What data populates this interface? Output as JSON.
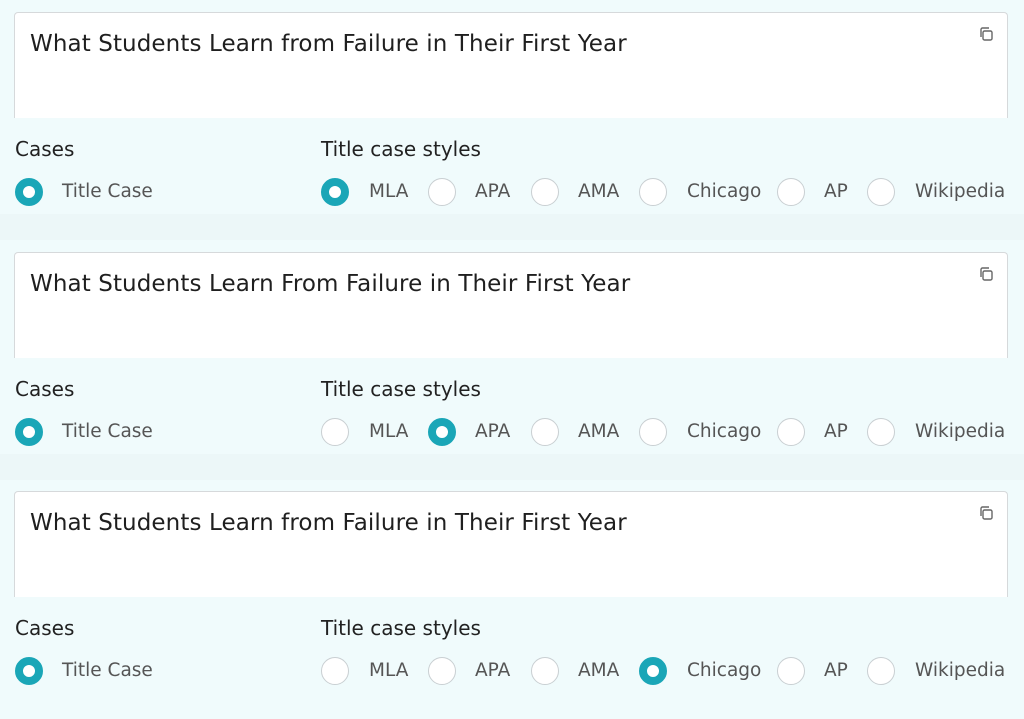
{
  "colors": {
    "accent": "#1aa6b7",
    "panel_bg": "#f0fbfc"
  },
  "blocks": [
    {
      "text": "What Students Learn from Failure in Their First Year",
      "cases_label": "Cases",
      "case_option": "Title Case",
      "styles_label": "Title case styles",
      "styles": [
        "MLA",
        "APA",
        "AMA",
        "Chicago",
        "AP",
        "Wikipedia"
      ],
      "selected_style": "MLA"
    },
    {
      "text": "What Students Learn From Failure in Their First Year",
      "cases_label": "Cases",
      "case_option": "Title Case",
      "styles_label": "Title case styles",
      "styles": [
        "MLA",
        "APA",
        "AMA",
        "Chicago",
        "AP",
        "Wikipedia"
      ],
      "selected_style": "APA"
    },
    {
      "text": "What Students Learn from Failure in Their First Year",
      "cases_label": "Cases",
      "case_option": "Title Case",
      "styles_label": "Title case styles",
      "styles": [
        "MLA",
        "APA",
        "AMA",
        "Chicago",
        "AP",
        "Wikipedia"
      ],
      "selected_style": "Chicago"
    }
  ]
}
